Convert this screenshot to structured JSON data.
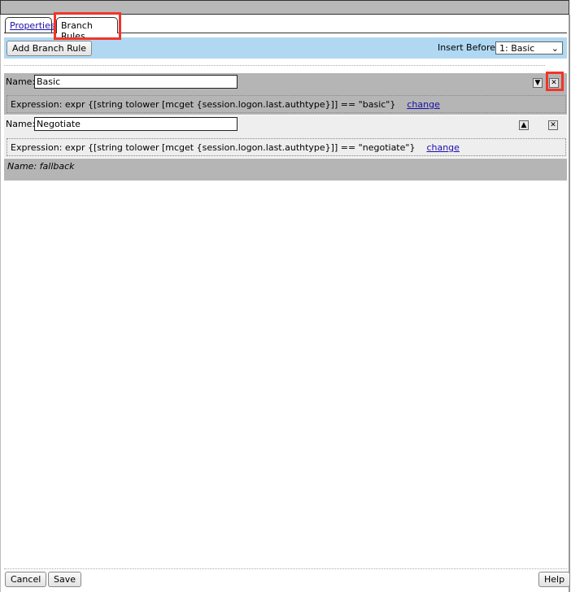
{
  "tabs": [
    {
      "label": "Properties",
      "active": false
    },
    {
      "label": "Branch Rules",
      "active": true
    }
  ],
  "toolbar": {
    "add_label": "Add Branch Rule",
    "insert_label": "Insert Before:",
    "insert_value": "1: Basic"
  },
  "rules": [
    {
      "name_label": "Name:",
      "name": "Basic",
      "expression": "Expression: expr {[string tolower [mcget {session.logon.last.authtype}]] == \"basic\"}",
      "change": "change",
      "move_icon": "arrow-down-icon",
      "delete_icon": "close-icon"
    },
    {
      "name_label": "Name:",
      "name": "Negotiate",
      "expression": "Expression: expr {[string tolower [mcget {session.logon.last.authtype}]] == \"negotiate\"}",
      "change": "change",
      "move_icon": "arrow-up-icon",
      "delete_icon": "close-icon"
    }
  ],
  "fallback": "Name: fallback",
  "footer": {
    "cancel": "Cancel",
    "save": "Save",
    "help": "Help"
  },
  "colors": {
    "highlight": "#f0352a",
    "toolbar": "#b0d8f2",
    "rule_selected": "#b5b5b5",
    "rule_normal": "#eeeeee"
  }
}
